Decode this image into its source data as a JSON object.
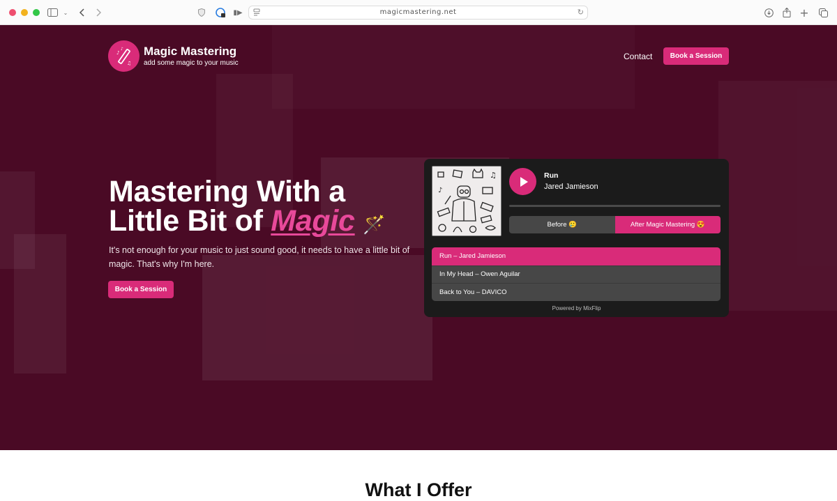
{
  "browser": {
    "url": "magicmastering.net",
    "icons": [
      "sidebar-icon",
      "chevron-down-icon",
      "back-icon",
      "forward-icon",
      "shield-icon",
      "privacy-report-icon",
      "media-icon",
      "page-menu-icon",
      "reload-icon",
      "download-icon",
      "share-icon",
      "new-tab-icon",
      "tabs-overview-icon"
    ]
  },
  "header": {
    "logo_title": "Magic Mastering",
    "logo_tagline": "add some magic to your music",
    "nav_contact": "Contact",
    "nav_book": "Book a Session"
  },
  "hero": {
    "headline_line1": "Mastering With a",
    "headline_line2_prefix": "Little Bit of ",
    "headline_highlight": "Magic",
    "headline_emoji": "🪄",
    "subtext": "It's not enough for your music to just sound good, it needs to have a little bit of magic. That's why I'm here.",
    "cta": "Book a Session"
  },
  "player": {
    "track_title": "Run",
    "track_artist": "Jared Jamieson",
    "progress_percent": 0,
    "before_label": "Before 🥲",
    "after_label": "After Magic Mastering 😍",
    "selected_mode": "after",
    "playlist": [
      {
        "label": "Run – Jared Jamieson",
        "active": true
      },
      {
        "label": "In My Head – Owen Aguilar",
        "active": false
      },
      {
        "label": "Back to You – DAVICO",
        "active": false
      }
    ],
    "powered_by": "Powered by MixFlip"
  },
  "colors": {
    "brand_pink": "#d92b79",
    "hero_bg": "#4a0a25",
    "player_bg": "#1b1b1b"
  },
  "offer": {
    "title": "What I Offer"
  }
}
